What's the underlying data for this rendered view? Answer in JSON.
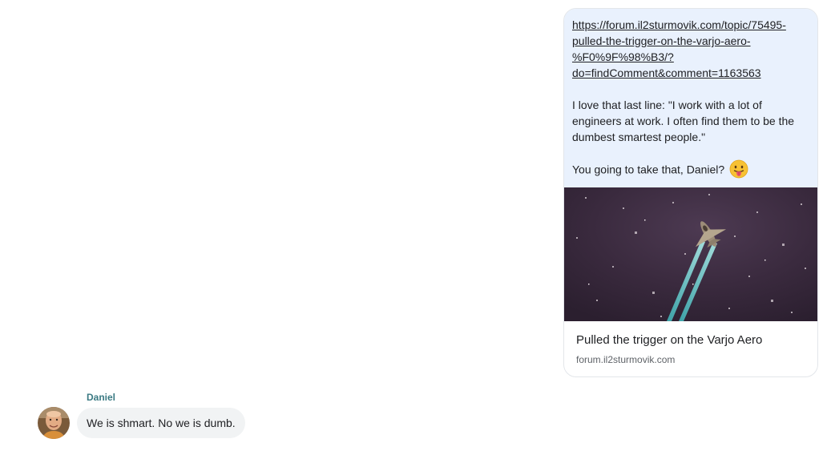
{
  "outgoing": {
    "link_line1": "https://forum.il2sturmovik.com/topic/75495-",
    "link_line2": "pulled-the-trigger-on-the-varjo-aero-",
    "link_line3": "%F0%9F%98%B3/?",
    "link_line4": "do=findComment&comment=1163563",
    "para1_line1": "I love that last line: \"I work with a lot of",
    "para1_line2": "engineers at work.  I often find them to be the",
    "para1_line3": "dumbest smartest people.\"",
    "para2": "You going to take that, Daniel?",
    "emoji_icon": "tongue-out-face",
    "preview": {
      "title": "Pulled the trigger on the Varjo Aero",
      "domain": "forum.il2sturmovik.com"
    },
    "bubble_color": "#e9f1fd"
  },
  "incoming": {
    "sender": "Daniel",
    "text": "We is shmart. No we is dumb.",
    "sender_color": "#3b7a83",
    "bubble_color": "#f1f3f4"
  }
}
